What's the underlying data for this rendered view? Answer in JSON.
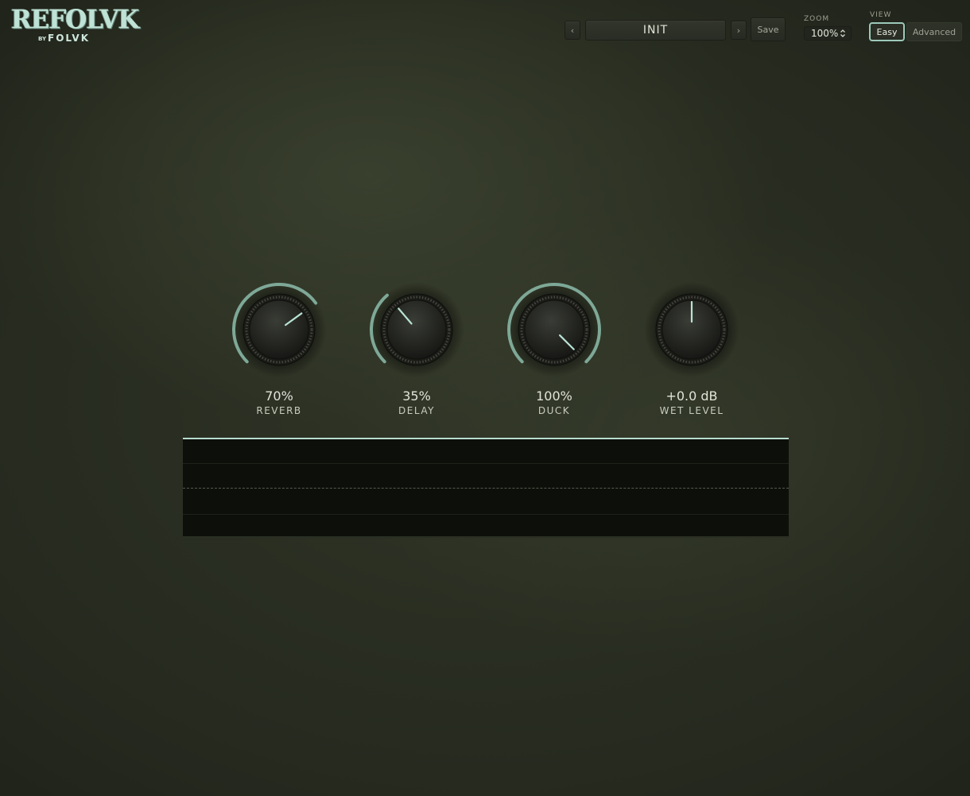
{
  "logo": {
    "main": "REFOLVK",
    "by": "BY",
    "brand": "FOLVK"
  },
  "topbar": {
    "prev_symbol": "‹",
    "next_symbol": "›",
    "preset_name": "INIT",
    "save_label": "Save",
    "zoom_label": "ZOOM",
    "zoom_value": "100%",
    "view_label": "VIEW",
    "view_options": [
      "Easy",
      "Advanced"
    ],
    "view_selected": "Easy"
  },
  "knobs": [
    {
      "id": "reverb",
      "label": "REVERB",
      "value": "70%",
      "amount": 0.7
    },
    {
      "id": "delay",
      "label": "DELAY",
      "value": "35%",
      "amount": 0.35
    },
    {
      "id": "duck",
      "label": "DUCK",
      "value": "100%",
      "amount": 1.0
    },
    {
      "id": "wet",
      "label": "WET LEVEL",
      "value": "+0.0 dB",
      "amount": 0.5,
      "bipolar": true
    }
  ],
  "colors": {
    "accent": "#7ea897",
    "indicator": "#b9e3d5",
    "display_bg": "#0d0f0a"
  }
}
